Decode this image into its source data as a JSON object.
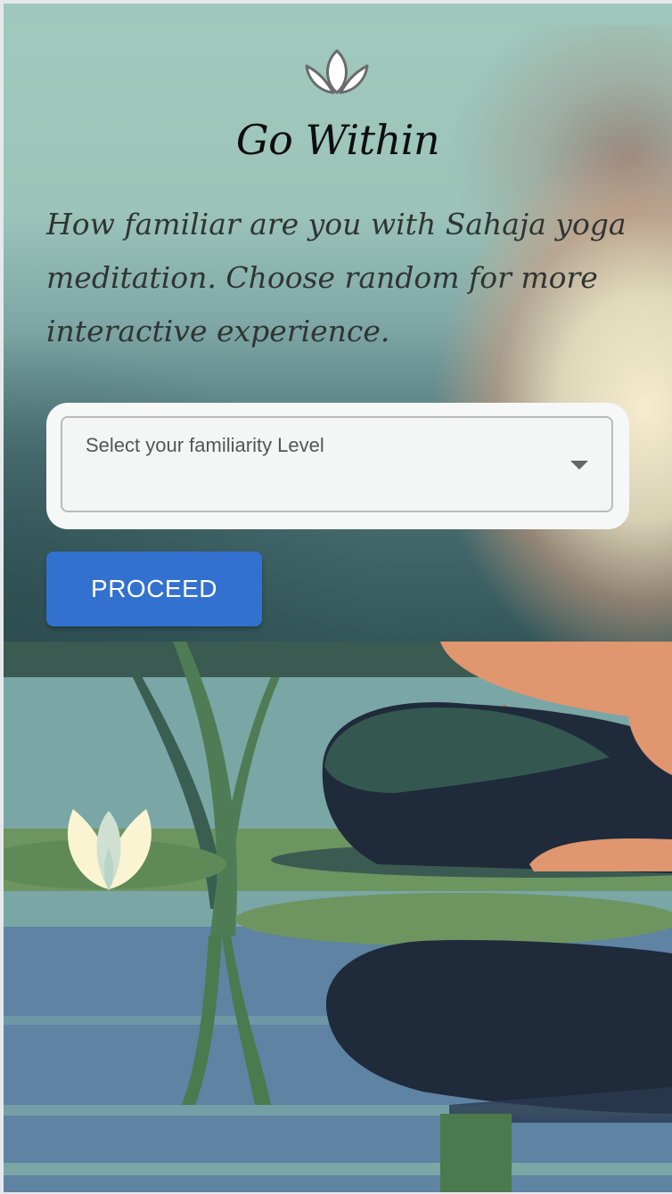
{
  "app": {
    "title": "Go Within",
    "logo_icon": "lotus-icon"
  },
  "intro": {
    "question": "How familiar are you with Sahaja yoga meditation. Choose random for more interactive experience."
  },
  "familiarity": {
    "label": "Select your familiarity Level",
    "value": "",
    "arrow_icon": "chevron-down-icon"
  },
  "actions": {
    "proceed_label": "PROCEED"
  },
  "colors": {
    "accent": "#3271cf",
    "hero_top": "#a0c8bd",
    "water": "#5f84a5",
    "leaf": "#6e9560"
  }
}
